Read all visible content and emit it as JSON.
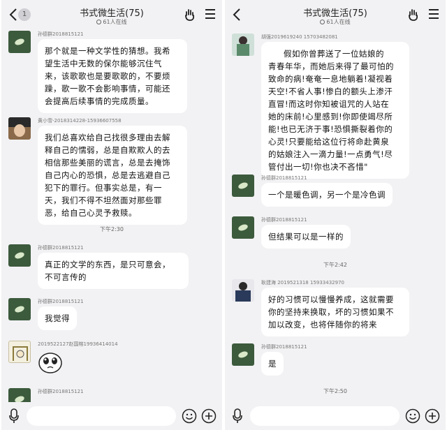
{
  "left": {
    "header": {
      "title": "书式微生活(75)",
      "online": "61人在线",
      "badge": "1"
    },
    "messages": [
      {
        "sender": "孙德群2018815121",
        "lines": [
          "那个就是一种文学性的猜想。我希",
          "望生活中无数的保尔能够沉住气",
          "来，该歌歌也是要歌歌的，不要烦",
          "躁，歌一歌不会影响事情，可能还",
          "会提高后续事情的完成质量。"
        ]
      },
      {
        "sender": "黄小雪-2018314228-15936607558",
        "lines": [
          "我们总喜欢给自己找很多理由去解",
          "释自己的懦弱，总是自欺欺人的去",
          "相信那些美丽的谎言，总是去掩饰",
          "自己内心的恐惧，总是去逃避自己",
          "犯下的罪行。但事实总是，有一",
          "天，我们不得不坦然面对那些罪",
          "恶，给自己心灵予救赎。"
        ]
      },
      {
        "time": "下午2:30"
      },
      {
        "sender": "孙德群2018815121",
        "lines": [
          "真正的文学的东西，是只可意会，",
          "不可言传的"
        ]
      },
      {
        "sender": "孙德群2018815121",
        "lines": [
          "我觉得"
        ]
      },
      {
        "sender": "2019522127赵国榕19936414014"
      },
      {
        "sender": "孙德群2018815121"
      }
    ]
  },
  "right": {
    "header": {
      "title": "书式微生活(75)",
      "online": "61人在线"
    },
    "messages": [
      {
        "sender": "胡强2019619240  15703482081",
        "lines": [
          "假如你曾葬送了一位姑娘的",
          "青春年华，而她后来得了最可怕的",
          "致命的病!奄奄一息地躺着!凝视着",
          "天空!不省人事!惨白的额头上渗汗",
          "直冒!而这时你知被诅咒的人站在",
          "她的床前!心里感到!你即使竭尽所",
          "能!也已无济于事!恐惧撕裂着你的",
          "心灵!只要能给这位行将命赴黄泉",
          "的姑娘注入一滴力量!一点勇气!尽",
          "管付出一切!你也决不吝惜\""
        ]
      },
      {
        "sender": "孙德群2018815121",
        "lines": [
          "一个是暖色调，另一个是冷色调"
        ]
      },
      {
        "sender": "孙德群2018815121",
        "lines": [
          "但结果可以是一样的"
        ]
      },
      {
        "time": "下午2:42"
      },
      {
        "sender": "耿建海  2019521318 15933432970",
        "lines": [
          "好的习惯可以慢慢养成，这就需要",
          "你的坚持来换取，坏的习惯如果不",
          "加以改变，也将伴随你的将来"
        ]
      },
      {
        "sender": "孙德群2018815121",
        "lines": [
          "是"
        ]
      },
      {
        "time": "下午2:50"
      }
    ]
  },
  "colors": {
    "panel_bg": "#f2f2f4",
    "bubble_bg": "#ffffff",
    "avatar_green": "#3c5a3c"
  },
  "icons": [
    "back-arrow-icon",
    "hand-gesture-icon",
    "menu-icon",
    "microphone-icon",
    "emoji-icon",
    "plus-icon"
  ]
}
